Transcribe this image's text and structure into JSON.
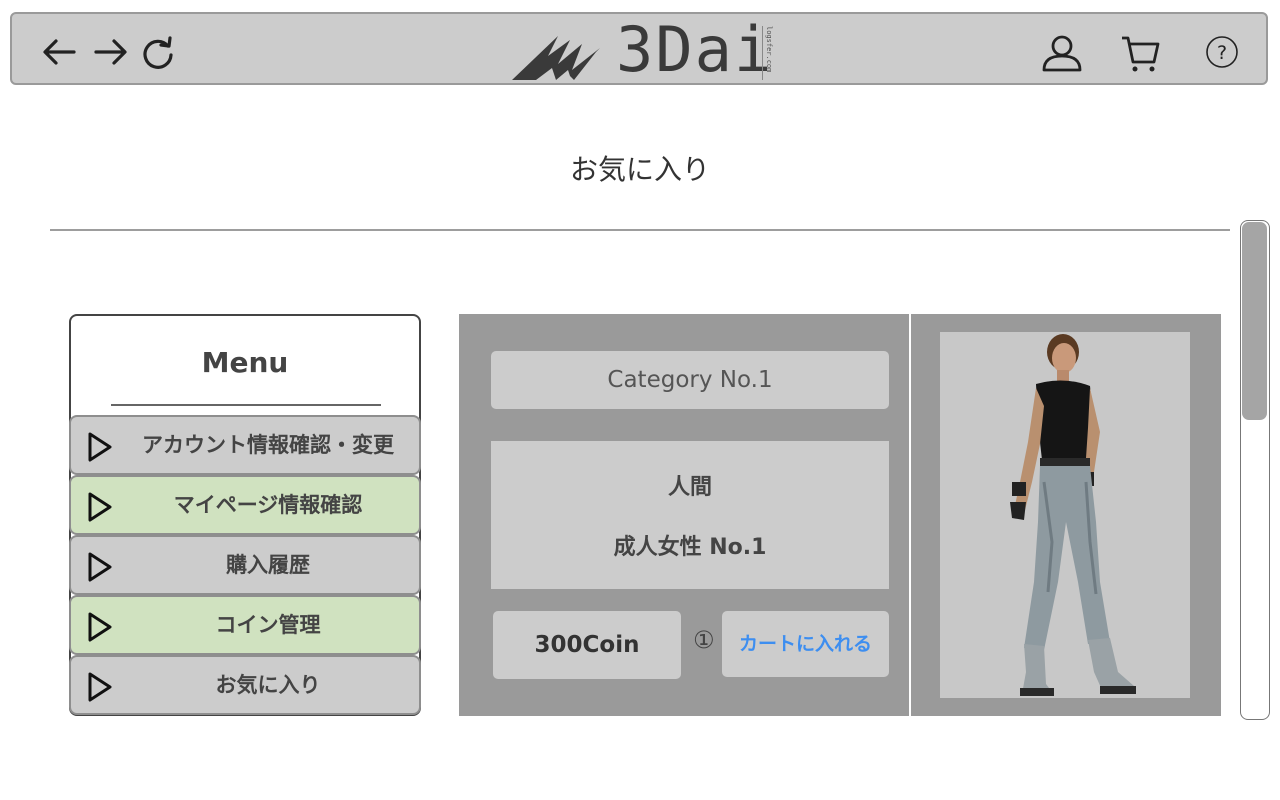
{
  "header": {
    "logo_text": "3Dai",
    "logo_subtext": "logsfer.com",
    "nav": [
      "back-arrow-icon",
      "forward-arrow-icon",
      "reload-icon"
    ],
    "icons": [
      "user-icon",
      "cart-icon",
      "help-icon"
    ]
  },
  "page": {
    "title": "お気に入り"
  },
  "menu": {
    "title": "Menu",
    "items": [
      {
        "label": "アカウント情報確認・変更",
        "bg": "#cccccc"
      },
      {
        "label": "マイページ情報確認",
        "bg": "#d0e2c0"
      },
      {
        "label": "購入履歴",
        "bg": "#cccccc"
      },
      {
        "label": "コイン管理",
        "bg": "#d0e2c0"
      },
      {
        "label": "お気に入り",
        "bg": "#cccccc"
      }
    ]
  },
  "product": {
    "category": "Category No.1",
    "type": "人間",
    "name": "成人女性 No.1",
    "price": "300Coin",
    "quantity": "①",
    "cart_button": "カートに入れる",
    "image": "female-3d-character-model"
  },
  "colors": {
    "header_bg": "#cccccc",
    "card_bg": "#9a9a9a",
    "pill_bg": "#cccccc",
    "menu_highlight": "#d0e2c0",
    "link_blue": "#3d8ef0"
  }
}
